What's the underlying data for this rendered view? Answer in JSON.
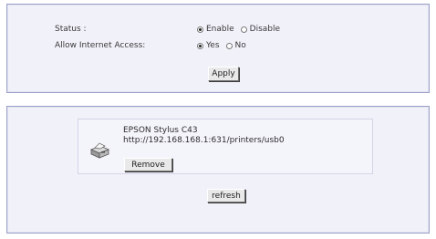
{
  "settings": {
    "status_label": "Status :",
    "status_options": {
      "enable": "Enable",
      "disable": "Disable"
    },
    "status_selected": "Enable",
    "internet_label": "Allow Internet Access:",
    "internet_options": {
      "yes": "Yes",
      "no": "No"
    },
    "internet_selected": "Yes",
    "apply_label": "Apply"
  },
  "printers": {
    "items": [
      {
        "name": "EPSON Stylus C43",
        "url": "http://192.168.168.1:631/printers/usb0",
        "icon": "printer-icon",
        "remove_label": "Remove"
      }
    ],
    "refresh_label": "refresh"
  }
}
